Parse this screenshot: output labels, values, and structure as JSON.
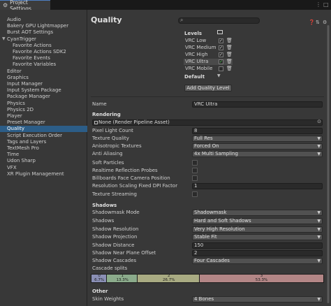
{
  "window": {
    "tab_title": "Project Settings"
  },
  "sidebar": {
    "items": [
      {
        "label": "Audio"
      },
      {
        "label": "Bakery GPU Lightmapper"
      },
      {
        "label": "Burst AOT Settings"
      },
      {
        "label": "CyanTrigger"
      },
      {
        "label": "Favorite Actions"
      },
      {
        "label": "Favorite Actions SDK2"
      },
      {
        "label": "Favorite Events"
      },
      {
        "label": "Favorite Variables"
      },
      {
        "label": "Editor"
      },
      {
        "label": "Graphics"
      },
      {
        "label": "Input Manager"
      },
      {
        "label": "Input System Package"
      },
      {
        "label": "Package Manager"
      },
      {
        "label": "Physics"
      },
      {
        "label": "Physics 2D"
      },
      {
        "label": "Player"
      },
      {
        "label": "Preset Manager"
      },
      {
        "label": "Quality"
      },
      {
        "label": "Script Execution Order"
      },
      {
        "label": "Tags and Layers"
      },
      {
        "label": "TextMesh Pro"
      },
      {
        "label": "Time"
      },
      {
        "label": "Udon Sharp"
      },
      {
        "label": "VFX"
      },
      {
        "label": "XR Plugin Management"
      }
    ]
  },
  "main": {
    "title": "Quality",
    "levels_title": "Levels",
    "levels": [
      {
        "name": "VRC Low",
        "checked": true,
        "check": "✓"
      },
      {
        "name": "VRC Medium",
        "checked": true,
        "check": "✓"
      },
      {
        "name": "VRC High",
        "checked": true,
        "check": "✓"
      },
      {
        "name": "VRC Ultra",
        "checked": true,
        "check": "✓"
      },
      {
        "name": "VRC Mobile",
        "checked": false,
        "check": ""
      }
    ],
    "default_label": "Default",
    "add_button": "Add Quality Level",
    "name_label": "Name",
    "name_value": "VRC Ultra",
    "rendering": {
      "title": "Rendering",
      "pipeline_asset": "None (Render Pipeline Asset)",
      "pixel_light_count_label": "Pixel Light Count",
      "pixel_light_count": "8",
      "texture_quality_label": "Texture Quality",
      "texture_quality": "Full Res",
      "anisotropic_label": "Anisotropic Textures",
      "anisotropic": "Forced On",
      "anti_aliasing_label": "Anti Aliasing",
      "anti_aliasing": "4x Multi Sampling",
      "soft_particles_label": "Soft Particles",
      "realtime_reflection_label": "Realtime Reflection Probes",
      "billboards_label": "Billboards Face Camera Position",
      "resolution_scaling_label": "Resolution Scaling Fixed DPI Factor",
      "resolution_scaling": "1",
      "texture_streaming_label": "Texture Streaming"
    },
    "shadows": {
      "title": "Shadows",
      "shadowmask_mode_label": "Shadowmask Mode",
      "shadowmask_mode": "Shadowmask",
      "shadows_label": "Shadows",
      "shadows": "Hard and Soft Shadows",
      "resolution_label": "Shadow Resolution",
      "resolution": "Very High Resolution",
      "projection_label": "Shadow Projection",
      "projection": "Stable Fit",
      "distance_label": "Shadow Distance",
      "distance": "150",
      "near_plane_label": "Shadow Near Plane Offset",
      "near_plane": "2",
      "cascades_label": "Shadow Cascades",
      "cascades": "Four Cascades",
      "cascade_splits_label": "Cascade splits",
      "cascade_splits": [
        {
          "index": "0",
          "pct": "6.7%",
          "color": "#8a8fb5"
        },
        {
          "index": "1",
          "pct": "13.3%",
          "color": "#8bab8b"
        },
        {
          "index": "2",
          "pct": "26.7%",
          "color": "#a9ab82"
        },
        {
          "index": "3",
          "pct": "53.3%",
          "color": "#b38686"
        }
      ]
    },
    "other": {
      "title": "Other",
      "skin_weights_label": "Skin Weights",
      "skin_weights": "4 Bones"
    }
  }
}
